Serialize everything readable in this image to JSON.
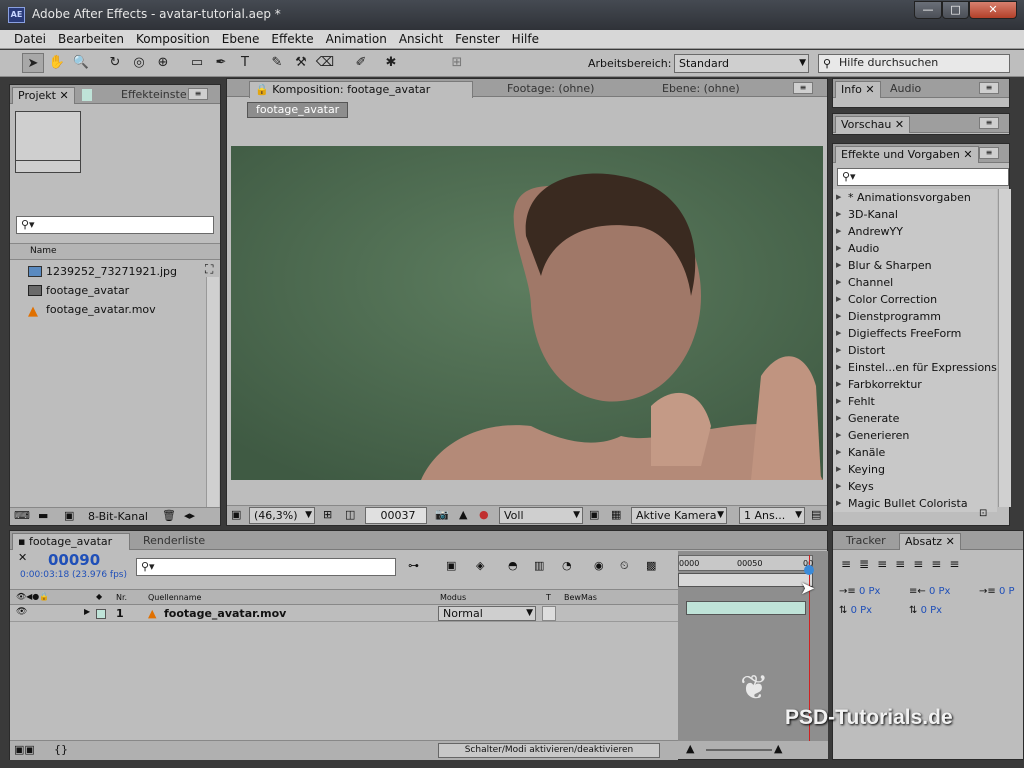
{
  "window": {
    "title": "Adobe After Effects - avatar-tutorial.aep *",
    "app_icon": "AE",
    "minimize": "—",
    "maximize": "□",
    "close": "✕"
  },
  "menu": [
    "Datei",
    "Bearbeiten",
    "Komposition",
    "Ebene",
    "Effekte",
    "Animation",
    "Ansicht",
    "Fenster",
    "Hilfe"
  ],
  "toolbar": {
    "workspace_label": "Arbeitsbereich:",
    "workspace_value": "Standard",
    "help_placeholder": "Hilfe durchsuchen"
  },
  "project": {
    "tab_label": "Projekt",
    "tab_effects": "Effekteinste",
    "search_placeholder": "",
    "column_name": "Name",
    "items": [
      {
        "name": "1239252_73271921.jpg",
        "icon": "image-icon"
      },
      {
        "name": "footage_avatar",
        "icon": "composition-icon"
      },
      {
        "name": "footage_avatar.mov",
        "icon": "vlc-cone-icon"
      }
    ],
    "bit_depth": "8-Bit-Kanal"
  },
  "viewer": {
    "comp_tab": "Komposition: footage_avatar",
    "footage_tab": "Footage: (ohne)",
    "layer_tab": "Ebene: (ohne)",
    "breadcrumb": "footage_avatar",
    "zoom": "(46,3%)",
    "timecode": "00037",
    "resolution": "Voll",
    "camera": "Aktive Kamera",
    "views": "1 Ans..."
  },
  "info_panel": {
    "tab_info": "Info",
    "tab_audio": "Audio"
  },
  "preview_panel": {
    "tab": "Vorschau"
  },
  "effects_panel": {
    "tab": "Effekte und Vorgaben",
    "search": "",
    "items": [
      "* Animationsvorgaben",
      "3D-Kanal",
      "AndrewYY",
      "Audio",
      "Blur & Sharpen",
      "Channel",
      "Color Correction",
      "Dienstprogramm",
      "Digieffects FreeForm",
      "Distort",
      "Einstel...en für Expressions",
      "Farbkorrektur",
      "Fehlt",
      "Generate",
      "Generieren",
      "Kanäle",
      "Keying",
      "Keys",
      "Magic Bullet Colorista"
    ]
  },
  "timeline": {
    "tab_comp": "footage_avatar",
    "tab_render": "Renderliste",
    "current_frame": "00090",
    "timecode_detail": "0:00:03:18 (23.976 fps)",
    "search": "",
    "col_nr": "Nr.",
    "col_source": "Quellenname",
    "col_mode": "Modus",
    "col_t": "T",
    "col_trkmat": "BewMas",
    "ruler_start": "0000",
    "ruler_mid": "00050",
    "ruler_end": "00",
    "layers": [
      {
        "nr": "1",
        "name": "footage_avatar.mov",
        "mode": "Normal"
      }
    ],
    "toggle_label": "Schalter/Modi aktivieren/deaktivieren",
    "playhead_fraction": 0.97
  },
  "tracker_panel": {
    "tab_tracker": "Tracker",
    "tab_paragraph": "Absatz",
    "indent_left": "0 Px",
    "indent_right": "0 Px",
    "indent_first": "0 P",
    "space_before": "0 Px",
    "space_after": "0 Px"
  },
  "watermark": {
    "text": "PSD-Tutorials.de"
  },
  "colors": {
    "green_screen": "#4f6e52",
    "timecode_blue": "#1f4fb8",
    "playhead": "#d02020",
    "accent_blue": "#3b8ad8"
  }
}
